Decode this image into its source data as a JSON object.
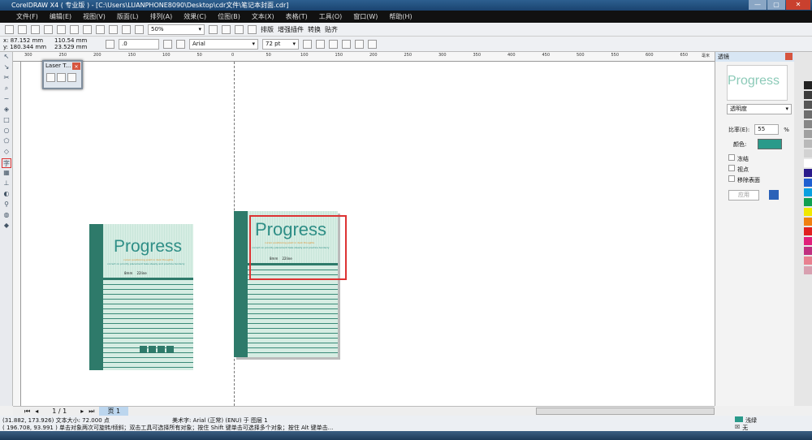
{
  "window": {
    "title": "CorelDRAW X4 ( 专业版 ) - [C:\\Users\\LUANPHONE8090\\Desktop\\cdr文件\\笔记本封面.cdr]"
  },
  "menu": [
    "文件(F)",
    "编辑(E)",
    "视图(V)",
    "版面(L)",
    "排列(A)",
    "效果(C)",
    "位图(B)",
    "文本(X)",
    "表格(T)",
    "工具(O)",
    "窗口(W)",
    "帮助(H)"
  ],
  "toolbar": {
    "zoom": "50%",
    "plugins": [
      "排版",
      "增强插件",
      "转换",
      "贴齐"
    ]
  },
  "propbar": {
    "x": "x: 87.152 mm",
    "y": "y: 180.344 mm",
    "w": "110.54 mm",
    "h": "23.529 mm",
    "angle": ".0",
    "font": "Arial",
    "size": "72 pt"
  },
  "ruler": {
    "labels": [
      "300",
      "250",
      "200",
      "150",
      "100",
      "50",
      "0",
      "50",
      "100",
      "150",
      "200",
      "250",
      "300",
      "350",
      "400",
      "450",
      "500",
      "550",
      "600",
      "650"
    ],
    "unit": "毫米"
  },
  "laser_panel": {
    "title": "Laser T..."
  },
  "covers": {
    "title": "Progress",
    "line1": "cursor positioning point in dark thoughts",
    "line2": "correct on priority placement take steady and practice tenderly",
    "spec1": "8mm",
    "spec2": "22line"
  },
  "docker": {
    "title": "透镜",
    "preview": "Progress",
    "lens_type": "透明度",
    "rate_label": "比率(E):",
    "rate_value": "55",
    "rate_unit": "%",
    "color_label": "颜色:",
    "color": "#2a9a8a",
    "checkboxes": [
      "冻结",
      "视点",
      "移除表面"
    ],
    "apply": "应用"
  },
  "pagenav": {
    "page_count": "1 / 1",
    "page_tab": "页 1"
  },
  "status": {
    "line1_coords": "(31.882, 173.926)",
    "line1_text": "文本大小: 72.000 点",
    "line1_mid": "美术字: Arial (正常) (ENU) 于 图层 1",
    "line2": "( 196.708, 93.991 ) 单击对象两次可旋转/倾斜；双击工具可选择所有对象；按住 Shift 键单击可选择多个对象；按住 Alt 键单击...",
    "fill": "浅绿",
    "outline": "无"
  },
  "colors": {
    "accent": "#2e7a6a",
    "palette": [
      "#222222",
      "#3c3c3c",
      "#555555",
      "#6e6e6e",
      "#878787",
      "#a0a0a0",
      "#b9b9b9",
      "#d2d2d2",
      "#ffffff",
      "#2a1a8a",
      "#1f5fd0",
      "#0aa0e0",
      "#10a050",
      "#f0e800",
      "#f08010",
      "#e02020",
      "#e0207a",
      "#c03080",
      "#e88090",
      "#d8a0b0"
    ]
  }
}
